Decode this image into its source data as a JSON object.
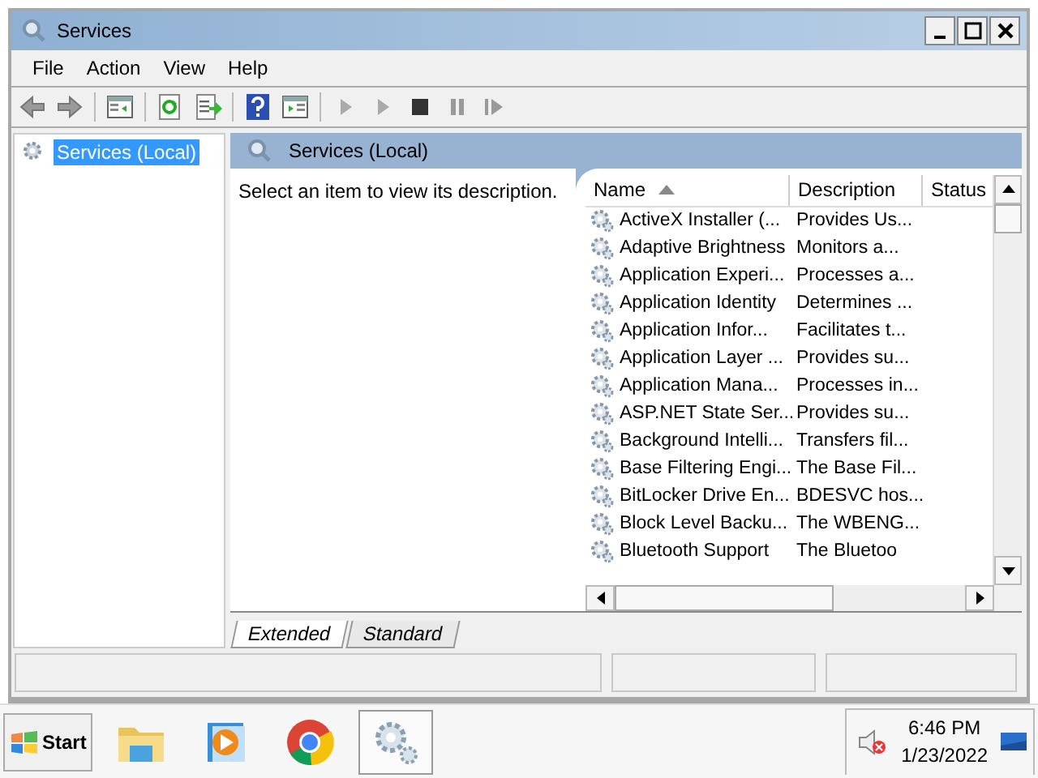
{
  "window": {
    "title": "Services"
  },
  "menu": [
    "File",
    "Action",
    "View",
    "Help"
  ],
  "tree": [
    {
      "label": "Services (Local)",
      "selected": true
    }
  ],
  "pane": {
    "title": "Services (Local)",
    "description": "Select an item to view its description."
  },
  "table": {
    "columns": [
      {
        "label": "Name",
        "sorted": true
      },
      {
        "label": "Description",
        "sorted": false
      },
      {
        "label": "Status",
        "sorted": false
      }
    ],
    "rows": [
      {
        "name": "ActiveX Installer (...",
        "description": "Provides Us..."
      },
      {
        "name": "Adaptive Brightness",
        "description": "Monitors a..."
      },
      {
        "name": "Application Experi...",
        "description": "Processes a..."
      },
      {
        "name": "Application Identity",
        "description": "Determines ..."
      },
      {
        "name": "Application Infor...",
        "description": "Facilitates t..."
      },
      {
        "name": "Application Layer ...",
        "description": "Provides su..."
      },
      {
        "name": "Application Mana...",
        "description": "Processes in..."
      },
      {
        "name": "ASP.NET State Ser...",
        "description": "Provides su..."
      },
      {
        "name": "Background Intelli...",
        "description": "Transfers fil..."
      },
      {
        "name": "Base Filtering Engi...",
        "description": "The Base Fil..."
      },
      {
        "name": "BitLocker Drive En...",
        "description": "BDESVC hos..."
      },
      {
        "name": "Block Level Backu...",
        "description": "The WBENG..."
      },
      {
        "name": "Bluetooth Support",
        "description": "The Bluetoo"
      }
    ]
  },
  "tabs": [
    {
      "label": "Extended",
      "selected": true
    },
    {
      "label": "Standard",
      "selected": false
    }
  ],
  "taskbar": {
    "start": "Start",
    "apps": [
      {
        "kind": "folder",
        "active": false
      },
      {
        "kind": "media",
        "active": false
      },
      {
        "kind": "browser",
        "active": false
      },
      {
        "kind": "gears",
        "active": true
      }
    ],
    "time": "6:46 PM",
    "date": "1/23/2022"
  }
}
